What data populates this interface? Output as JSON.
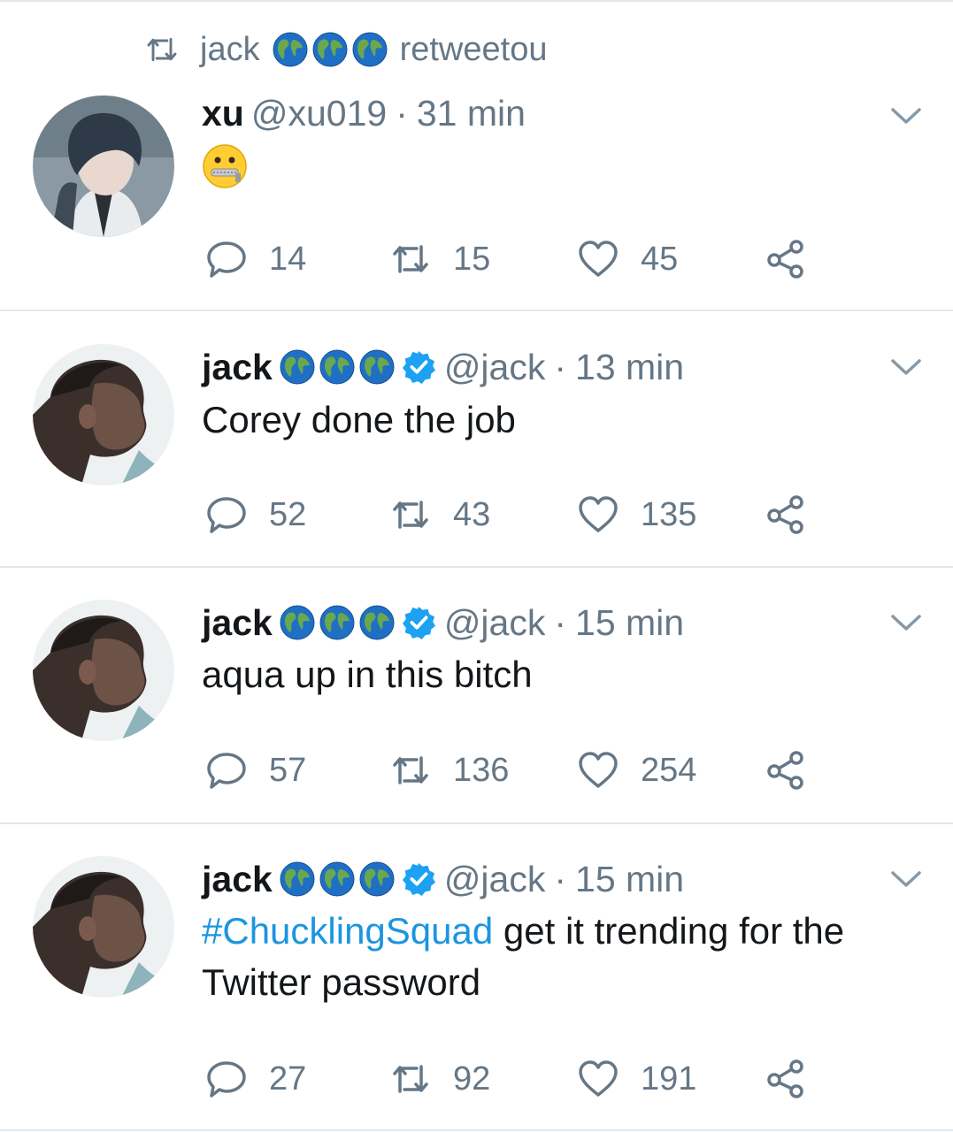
{
  "colors": {
    "text": "#14171a",
    "muted": "#657786",
    "link": "#1b95e0",
    "verified": "#1da1f2",
    "divider": "#e1e8ed"
  },
  "retweet_line": {
    "user": "jack",
    "globes": [
      "globe-icon",
      "globe-icon",
      "globe-icon"
    ],
    "label": "retweetou"
  },
  "tweets": [
    {
      "name": "xu",
      "handle": "@xu019",
      "sep": "·",
      "time": "31 min",
      "globes": [],
      "verified": false,
      "emoji": "zipper-mouth-face-emoji",
      "text": "",
      "replies": "14",
      "retweets": "15",
      "likes": "45"
    },
    {
      "name": "jack",
      "handle": "@jack",
      "sep": "·",
      "time": "13 min",
      "globes": [
        "globe-icon",
        "globe-icon",
        "globe-icon"
      ],
      "verified": true,
      "text": "Corey done the job",
      "replies": "52",
      "retweets": "43",
      "likes": "135"
    },
    {
      "name": "jack",
      "handle": "@jack",
      "sep": "·",
      "time": "15 min",
      "globes": [
        "globe-icon",
        "globe-icon",
        "globe-icon"
      ],
      "verified": true,
      "text": "aqua up in this bitch",
      "replies": "57",
      "retweets": "136",
      "likes": "254"
    },
    {
      "name": "jack",
      "handle": "@jack",
      "sep": "·",
      "time": "15 min",
      "globes": [
        "globe-icon",
        "globe-icon",
        "globe-icon"
      ],
      "verified": true,
      "hashtag": "#ChucklingSquad",
      "text_line1": " get it trending for the",
      "text_line2": "Twitter password",
      "replies": "27",
      "retweets": "92",
      "likes": "191"
    }
  ]
}
